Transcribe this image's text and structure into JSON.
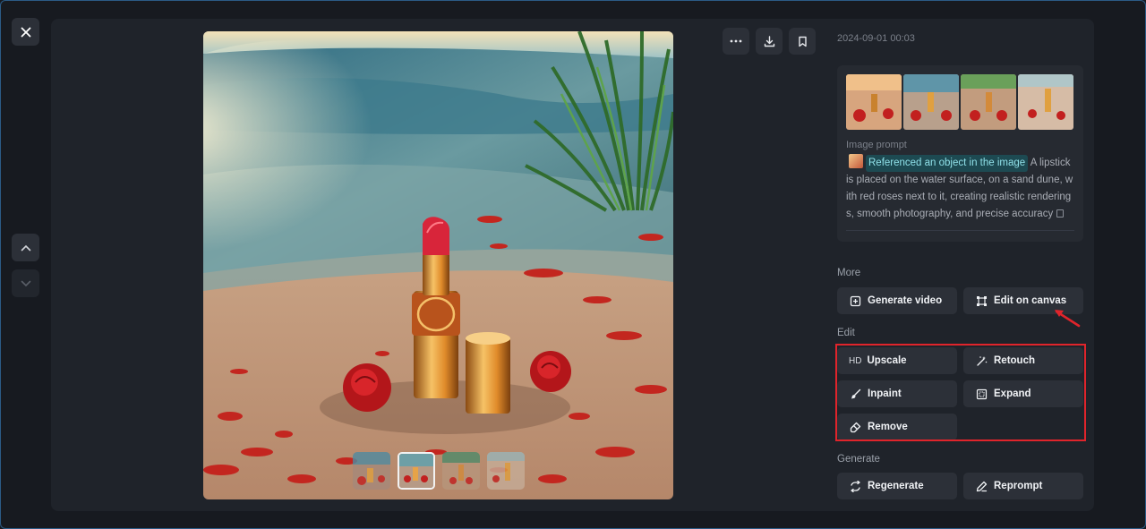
{
  "header": {
    "timestamp": "2024-09-01 00:03"
  },
  "toolbar": {
    "more_icon": "more-horizontal-icon",
    "download_icon": "download-icon",
    "bookmark_icon": "bookmark-icon"
  },
  "navigation": {
    "close_icon": "close-icon",
    "up_icon": "chevron-up-icon",
    "down_icon": "chevron-down-icon"
  },
  "prompt": {
    "label": "Image prompt",
    "reference_chip": "Referenced an object in the image",
    "text": "A lipstick is placed on the water surface, on a sand dune, with red roses next to it, creating realistic renderings, smooth photography, and precise accuracy"
  },
  "sections": {
    "more": {
      "label": "More",
      "buttons": [
        {
          "label": "Generate video",
          "icon": "video-plus-icon"
        },
        {
          "label": "Edit on canvas",
          "icon": "canvas-frame-icon"
        }
      ]
    },
    "edit": {
      "label": "Edit",
      "buttons": [
        {
          "label": "Upscale",
          "icon": "HD"
        },
        {
          "label": "Retouch",
          "icon": "magic-wand-icon"
        },
        {
          "label": "Inpaint",
          "icon": "brush-icon"
        },
        {
          "label": "Expand",
          "icon": "expand-frame-icon"
        },
        {
          "label": "Remove",
          "icon": "eraser-icon"
        }
      ]
    },
    "generate": {
      "label": "Generate",
      "buttons": [
        {
          "label": "Regenerate",
          "icon": "refresh-icon"
        },
        {
          "label": "Reprompt",
          "icon": "pencil-icon"
        }
      ]
    }
  },
  "colors": {
    "background": "#171a20",
    "panel": "#1f232a",
    "button": "#2c3038",
    "highlight": "#e0242b",
    "chip": "#1d4a52"
  }
}
